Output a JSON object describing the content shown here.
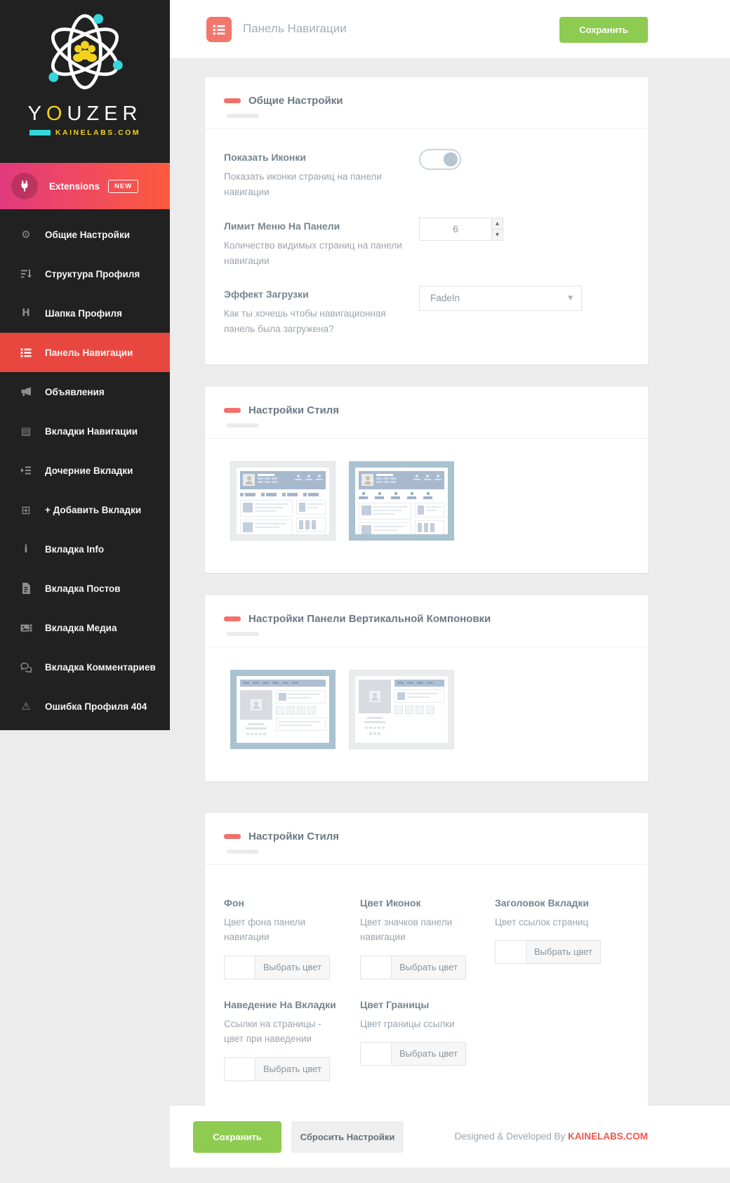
{
  "sidebar": {
    "logo": {
      "brand_part1": "Y",
      "brand_part2": "O",
      "brand_part3": "UZER",
      "subtitle": "KAINELABS.COM"
    },
    "extensions": {
      "label": "Extensions",
      "badge": "NEW"
    },
    "items": [
      {
        "label": "Общие Настройки",
        "icon": "gears-icon"
      },
      {
        "label": "Структура Профиля",
        "icon": "sort-icon"
      },
      {
        "label": "Шапка Профиля",
        "icon": "header-h-icon"
      },
      {
        "label": "Панель Навигации",
        "icon": "list-icon",
        "active": true
      },
      {
        "label": "Объявления",
        "icon": "megaphone-icon"
      },
      {
        "label": "Вкладки Навигации",
        "icon": "list-alt-icon"
      },
      {
        "label": "Дочерние Вкладки",
        "icon": "indent-list-icon"
      },
      {
        "label": "+ Добавить Вкладки",
        "icon": "plus-square-icon"
      },
      {
        "label": "Вкладка Info",
        "icon": "info-icon"
      },
      {
        "label": "Вкладка Постов",
        "icon": "file-icon"
      },
      {
        "label": "Вкладка Медиа",
        "icon": "media-icon"
      },
      {
        "label": "Вкладка Комментариев",
        "icon": "comments-icon"
      },
      {
        "label": "Ошибка Профиля 404",
        "icon": "warning-icon"
      }
    ]
  },
  "header": {
    "title": "Панель Навигации",
    "save_label": "Сохранить"
  },
  "sections": {
    "general": {
      "title": "Общие Настройки",
      "rows": [
        {
          "label": "Показать Иконки",
          "description": "Показать иконки страниц на панели навигации",
          "control": "toggle",
          "value": "on"
        },
        {
          "label": "Лимит Меню На Панели",
          "description": "Количество видимых страниц на панели навигации",
          "control": "number",
          "value": "6"
        },
        {
          "label": "Эффект Загрузки",
          "description": "Как ты хочешь чтобы навигационная панель была загружена?",
          "control": "select",
          "value": "FadeIn"
        }
      ]
    },
    "style_layout": {
      "title": "Настройки Стиля"
    },
    "vertical_layout": {
      "title": "Настройки Панели Вертикальной Компоновки"
    },
    "style_colors": {
      "title": "Настройки Стиля",
      "pickers": [
        {
          "label": "Фон",
          "description": "Цвет фона панели навигации",
          "button": "Выбрать цвет"
        },
        {
          "label": "Цвет Иконок",
          "description": "Цвет значков панели навигации",
          "button": "Выбрать цвет"
        },
        {
          "label": "Заголовок Вкладки",
          "description": "Цвет ссылок страниц",
          "button": "Выбрать цвет"
        },
        {
          "label": "Наведение На Вкладки",
          "description": "Ссылки на страницы - цвет при наведении",
          "button": "Выбрать цвет"
        },
        {
          "label": "Цвет Границы",
          "description": "Цвет границы ссылки",
          "button": "Выбрать цвет"
        }
      ]
    }
  },
  "footer": {
    "save_label": "Сохранить",
    "reset_label": "Сбросить Настройки",
    "credit": "Designed & Developed By",
    "credit_link": "KAINELABS.COM"
  },
  "icons": {
    "caret_down": "▼",
    "spin_up": "▲",
    "spin_down": "▼",
    "gears": "⚙",
    "header_h": "H",
    "list_alt": "▤",
    "plus_square": "⊞",
    "info": "i",
    "warning": "⚠"
  },
  "colors": {
    "accent_red": "#e8473f",
    "salmon": "#f3766d",
    "green": "#8ecb51",
    "link_red": "#f0564c",
    "gradient_start": "#e23a7e",
    "gradient_end": "#fd5b3f",
    "cyan": "#35d6da",
    "yellow": "#f2d21f",
    "thumb_blue": "#a8b9ce",
    "thumb_selected_border": "#a9c2d0",
    "sidebar_bg": "#212121",
    "page_bg": "#ececec"
  }
}
